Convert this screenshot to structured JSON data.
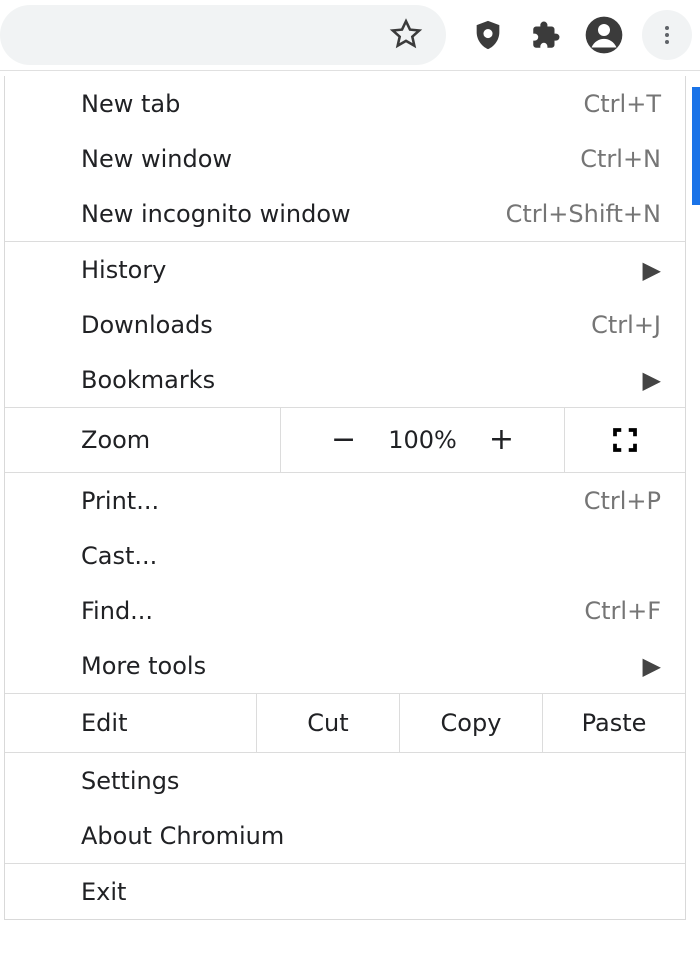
{
  "toolbar": {
    "star": "star-icon",
    "privacy": "shield-icon",
    "extensions": "puzzle-icon",
    "account": "account-icon",
    "more": "vertical-dots-icon"
  },
  "menu": {
    "new_tab": {
      "label": "New tab",
      "shortcut": "Ctrl+T"
    },
    "new_window": {
      "label": "New window",
      "shortcut": "Ctrl+N"
    },
    "new_incognito": {
      "label": "New incognito window",
      "shortcut": "Ctrl+Shift+N"
    },
    "history": {
      "label": "History"
    },
    "downloads": {
      "label": "Downloads",
      "shortcut": "Ctrl+J"
    },
    "bookmarks": {
      "label": "Bookmarks"
    },
    "zoom": {
      "label": "Zoom",
      "level": "100%"
    },
    "print": {
      "label": "Print...",
      "shortcut": "Ctrl+P"
    },
    "cast": {
      "label": "Cast..."
    },
    "find": {
      "label": "Find...",
      "shortcut": "Ctrl+F"
    },
    "more_tools": {
      "label": "More tools"
    },
    "edit": {
      "label": "Edit",
      "cut": "Cut",
      "copy": "Copy",
      "paste": "Paste"
    },
    "settings": {
      "label": "Settings"
    },
    "about": {
      "label": "About Chromium"
    },
    "exit": {
      "label": "Exit"
    }
  }
}
